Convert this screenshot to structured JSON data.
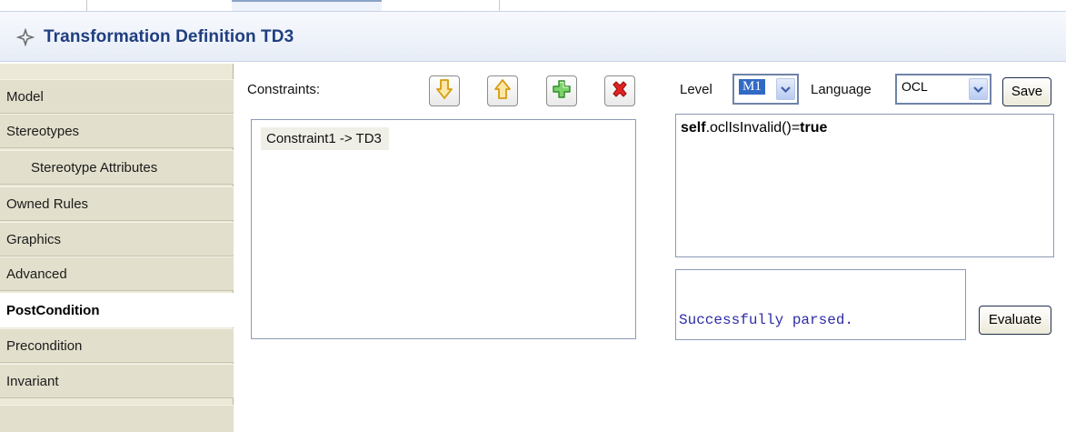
{
  "header": {
    "title": "Transformation Definition TD3",
    "icon": "diamond-icon"
  },
  "sidebar": {
    "items": [
      {
        "label": "Model",
        "sub": false,
        "selected": false
      },
      {
        "label": "Stereotypes",
        "sub": false,
        "selected": false
      },
      {
        "label": "Stereotype Attributes",
        "sub": true,
        "selected": false
      },
      {
        "label": "Owned Rules",
        "sub": false,
        "selected": false
      },
      {
        "label": "Graphics",
        "sub": false,
        "selected": false
      },
      {
        "label": "Advanced",
        "sub": false,
        "selected": false
      },
      {
        "label": "PostCondition",
        "sub": false,
        "selected": true
      },
      {
        "label": "Precondition",
        "sub": false,
        "selected": false
      },
      {
        "label": "Invariant",
        "sub": false,
        "selected": false
      }
    ]
  },
  "constraints": {
    "label": "Constraints:",
    "items": [
      "Constraint1 -> TD3"
    ],
    "toolbar": [
      "move-down-icon",
      "move-up-icon",
      "add-icon",
      "delete-icon"
    ]
  },
  "settings": {
    "level_label": "Level",
    "level_value": "M1",
    "language_label": "Language",
    "language_value": "OCL",
    "save_label": "Save"
  },
  "editor": {
    "code_parts": {
      "kw1": "self",
      "mid": ".oclIsInvalid()=",
      "kw2": "true"
    }
  },
  "result": {
    "message": "Successfully parsed.",
    "evaluate_label": "Evaluate"
  },
  "colors": {
    "title": "#1f3e80",
    "result_text": "#2c2ca6",
    "delete": "#d81e1e",
    "add": "#3aa133",
    "arrows": "#e0a31a"
  }
}
